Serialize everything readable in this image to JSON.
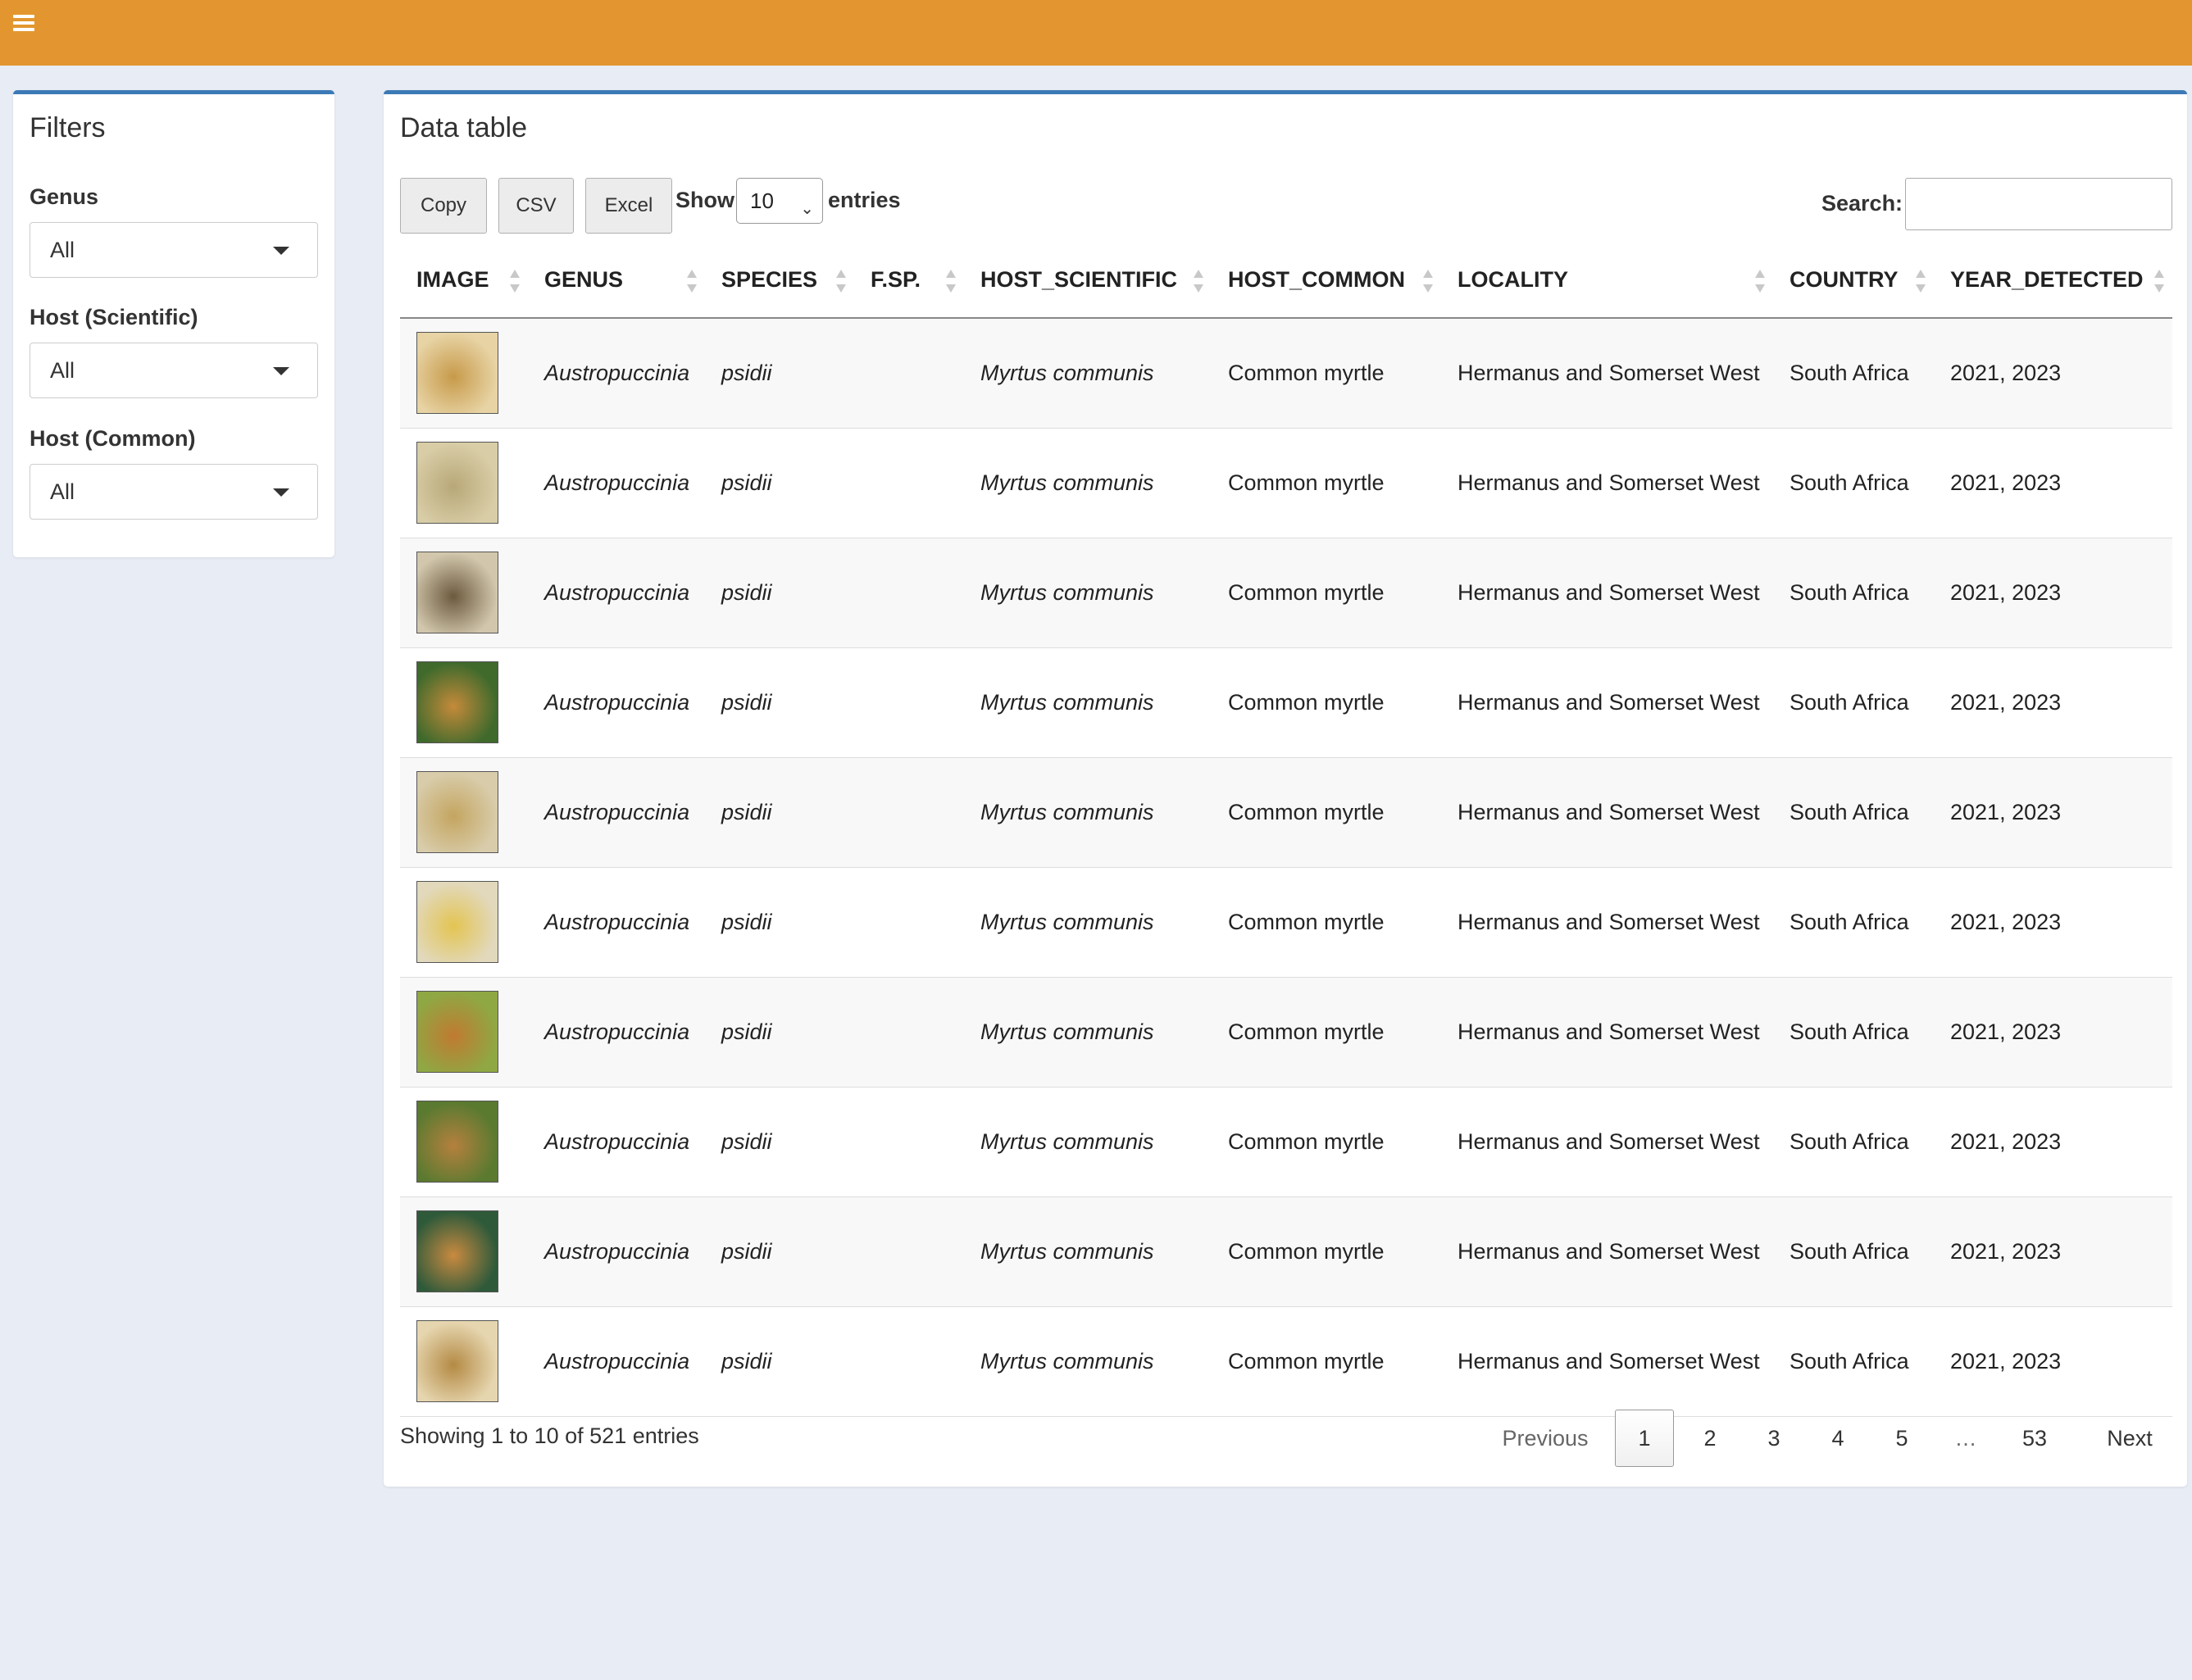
{
  "topbar": {
    "color": "#e3962f",
    "menu_icon": "hamburger-icon"
  },
  "filters": {
    "title": "Filters",
    "items": [
      {
        "label": "Genus",
        "value": "All"
      },
      {
        "label": "Host (Scientific)",
        "value": "All"
      },
      {
        "label": "Host (Common)",
        "value": "All"
      }
    ]
  },
  "table_box": {
    "title": "Data table",
    "buttons": {
      "copy": "Copy",
      "csv": "CSV",
      "excel": "Excel"
    },
    "show_label": "Show",
    "length_value": "10",
    "entries_label": "entries",
    "search_label": "Search:",
    "search_value": ""
  },
  "table": {
    "columns": [
      "IMAGE",
      "GENUS",
      "SPECIES",
      "F.SP.",
      "HOST_SCIENTIFIC",
      "HOST_COMMON",
      "LOCALITY",
      "COUNTRY",
      "YEAR_DETECTED"
    ],
    "rows": [
      {
        "genus": "Austropuccinia",
        "species": "psidii",
        "fsp": "",
        "host_scientific": "Myrtus communis",
        "host_common": "Common myrtle",
        "locality": "Hermanus and Somerset West",
        "country": "South Africa",
        "year": "2021, 2023",
        "thumb": [
          "#e7d3a4",
          "#c79a4a"
        ]
      },
      {
        "genus": "Austropuccinia",
        "species": "psidii",
        "fsp": "",
        "host_scientific": "Myrtus communis",
        "host_common": "Common myrtle",
        "locality": "Hermanus and Somerset West",
        "country": "South Africa",
        "year": "2021, 2023",
        "thumb": [
          "#d9cda7",
          "#b8a878"
        ]
      },
      {
        "genus": "Austropuccinia",
        "species": "psidii",
        "fsp": "",
        "host_scientific": "Myrtus communis",
        "host_common": "Common myrtle",
        "locality": "Hermanus and Somerset West",
        "country": "South Africa",
        "year": "2021, 2023",
        "thumb": [
          "#d2c7ad",
          "#6c5a3e"
        ]
      },
      {
        "genus": "Austropuccinia",
        "species": "psidii",
        "fsp": "",
        "host_scientific": "Myrtus communis",
        "host_common": "Common myrtle",
        "locality": "Hermanus and Somerset West",
        "country": "South Africa",
        "year": "2021, 2023",
        "thumb": [
          "#3f6a2c",
          "#c58a3a"
        ]
      },
      {
        "genus": "Austropuccinia",
        "species": "psidii",
        "fsp": "",
        "host_scientific": "Myrtus communis",
        "host_common": "Common myrtle",
        "locality": "Hermanus and Somerset West",
        "country": "South Africa",
        "year": "2021, 2023",
        "thumb": [
          "#d8ccaa",
          "#c4a560"
        ]
      },
      {
        "genus": "Austropuccinia",
        "species": "psidii",
        "fsp": "",
        "host_scientific": "Myrtus communis",
        "host_common": "Common myrtle",
        "locality": "Hermanus and Somerset West",
        "country": "South Africa",
        "year": "2021, 2023",
        "thumb": [
          "#e2d9bd",
          "#e3c452"
        ]
      },
      {
        "genus": "Austropuccinia",
        "species": "psidii",
        "fsp": "",
        "host_scientific": "Myrtus communis",
        "host_common": "Common myrtle",
        "locality": "Hermanus and Somerset West",
        "country": "South Africa",
        "year": "2021, 2023",
        "thumb": [
          "#8fa844",
          "#c07a30"
        ]
      },
      {
        "genus": "Austropuccinia",
        "species": "psidii",
        "fsp": "",
        "host_scientific": "Myrtus communis",
        "host_common": "Common myrtle",
        "locality": "Hermanus and Somerset West",
        "country": "South Africa",
        "year": "2021, 2023",
        "thumb": [
          "#5a7a30",
          "#b5803e"
        ]
      },
      {
        "genus": "Austropuccinia",
        "species": "psidii",
        "fsp": "",
        "host_scientific": "Myrtus communis",
        "host_common": "Common myrtle",
        "locality": "Hermanus and Somerset West",
        "country": "South Africa",
        "year": "2021, 2023",
        "thumb": [
          "#2f5a3a",
          "#c98a40"
        ]
      },
      {
        "genus": "Austropuccinia",
        "species": "psidii",
        "fsp": "",
        "host_scientific": "Myrtus communis",
        "host_common": "Common myrtle",
        "locality": "Hermanus and Somerset West",
        "country": "South Africa",
        "year": "2021, 2023",
        "thumb": [
          "#e6d6b0",
          "#b48a44"
        ]
      }
    ]
  },
  "footer": {
    "info": "Showing 1 to 10 of 521 entries",
    "pagination": {
      "previous": "Previous",
      "pages": [
        "1",
        "2",
        "3",
        "4",
        "5",
        "…",
        "53"
      ],
      "current": "1",
      "next": "Next"
    }
  },
  "colors": {
    "accent": "#3c7ab6",
    "header": "#e3962f",
    "background": "#e8ecf4"
  }
}
